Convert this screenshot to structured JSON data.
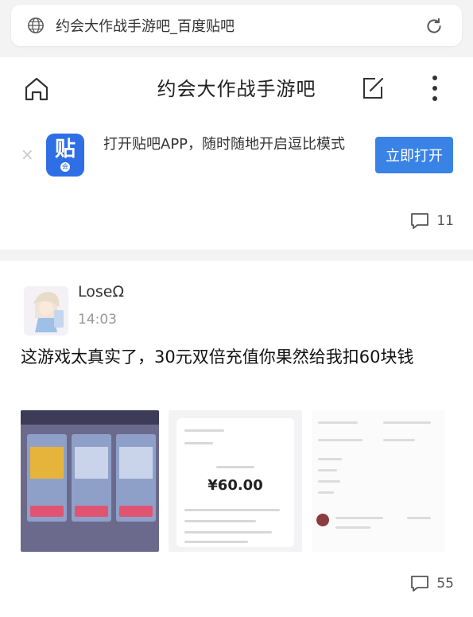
{
  "browser": {
    "url_title": "约会大作战手游吧_百度贴吧",
    "icons": [
      "globe-icon",
      "reload-icon"
    ]
  },
  "header": {
    "title": "约会大作战手游吧",
    "icons": [
      "home-icon",
      "edit-icon",
      "more-icon"
    ]
  },
  "banner": {
    "close_glyph": "×",
    "app_icon_glyph": "贴",
    "app_icon_badge": "会",
    "promo_text": "打开贴吧APP，随时随地开启逗比模式",
    "open_button": "立即打开",
    "accent_color": "#3a83e6"
  },
  "prev_post": {
    "comment_count": "11"
  },
  "post": {
    "username": "LoseΩ",
    "time": "14:03",
    "content": "这游戏太真实了，30元双倍充值你果然给我扣60块钱",
    "screenshot_price": "¥60.00",
    "comment_count": "55"
  }
}
